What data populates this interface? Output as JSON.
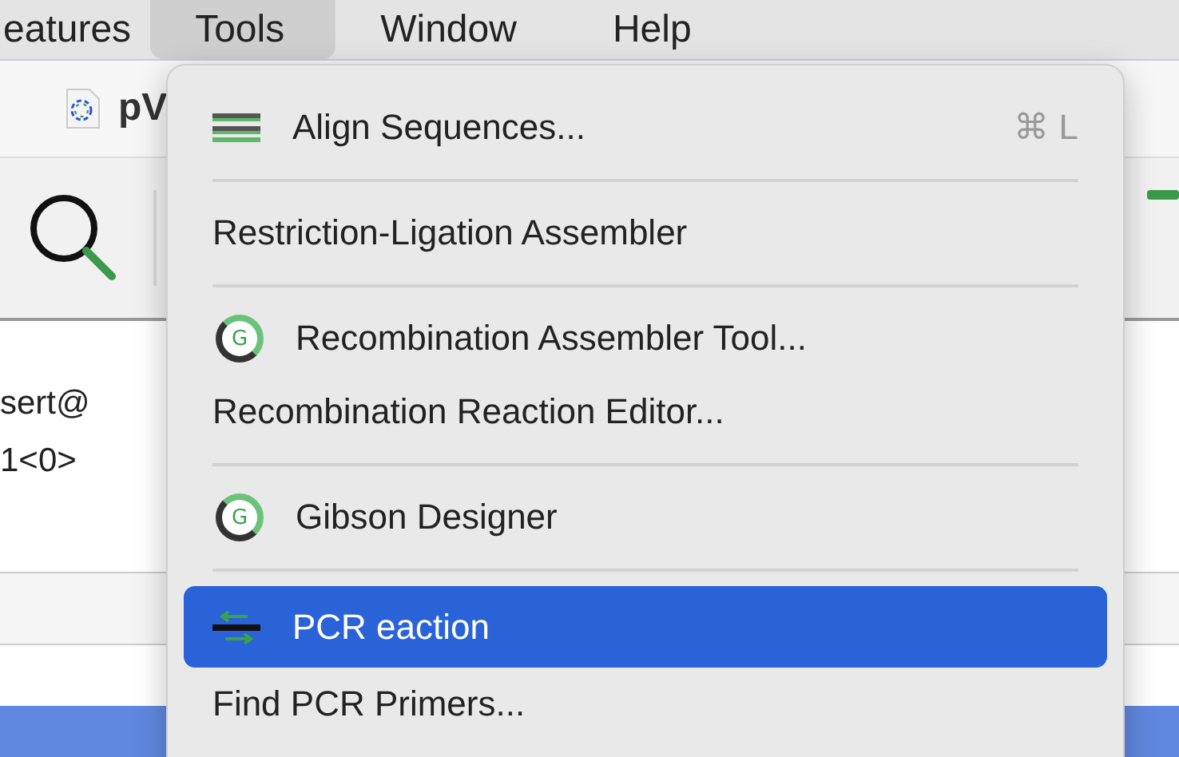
{
  "menu_bar": [
    {
      "label": "eatures",
      "selected": false
    },
    {
      "label": "Tools",
      "selected": true
    },
    {
      "label": "Window",
      "selected": false
    },
    {
      "label": "Help",
      "selected": false
    }
  ],
  "document_tab": {
    "title": "pV"
  },
  "content_lines": [
    "sert@",
    "1<0>"
  ],
  "tools_menu": [
    {
      "kind": "align-item",
      "label": "Align Sequences...",
      "shortcut": "⌘ L",
      "selected": false
    },
    {
      "kind": "separator"
    },
    {
      "kind": "item",
      "label": "Restriction-Ligation Assembler",
      "selected": false
    },
    {
      "kind": "separator"
    },
    {
      "kind": "logo-item",
      "label": "Recombination Assembler Tool...",
      "logo_letter": "G",
      "selected": false
    },
    {
      "kind": "item",
      "label": "Recombination Reaction Editor...",
      "selected": false
    },
    {
      "kind": "separator"
    },
    {
      "kind": "logo-item",
      "label": "Gibson Designer",
      "logo_letter": "G",
      "selected": false
    },
    {
      "kind": "separator"
    },
    {
      "kind": "pcr-item",
      "label": "PCR eaction",
      "selected": true
    },
    {
      "kind": "item",
      "label": "Find PCR Primers...",
      "selected": false
    }
  ]
}
